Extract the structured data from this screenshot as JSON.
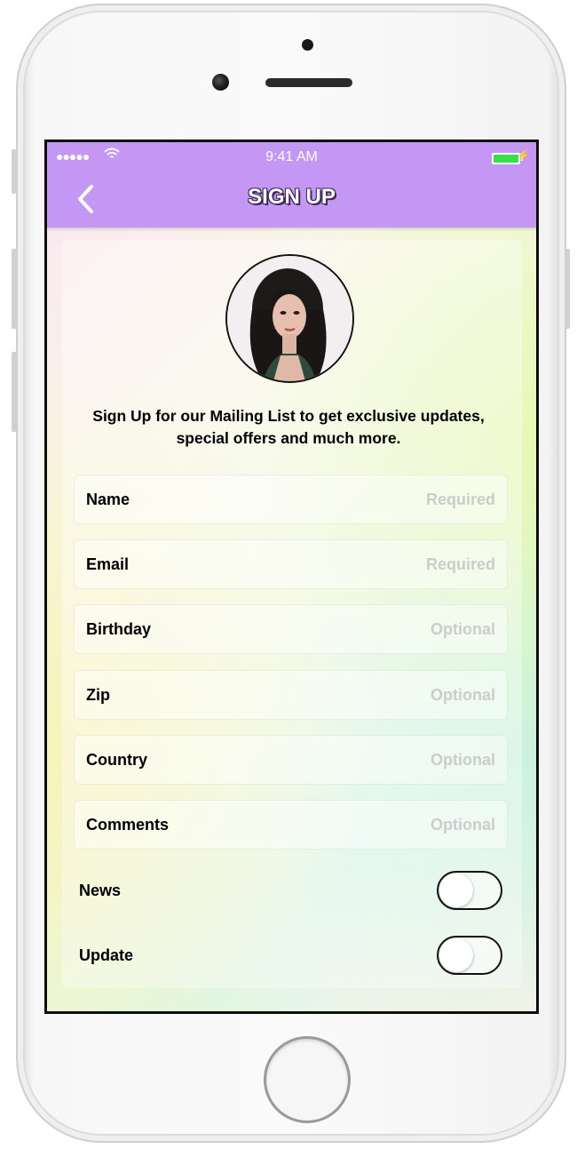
{
  "status_bar": {
    "signal": "●●●●●",
    "time": "9:41 AM"
  },
  "header": {
    "title": "SIGN UP",
    "back_icon": "chevron-left-icon"
  },
  "intro": {
    "line1": "Sign Up for our Mailing List to get exclusive updates,",
    "line2": "special offers and much more."
  },
  "fields": [
    {
      "label": "Name",
      "placeholder": "Required"
    },
    {
      "label": "Email",
      "placeholder": "Required"
    },
    {
      "label": "Birthday",
      "placeholder": "Optional"
    },
    {
      "label": "Zip",
      "placeholder": "Optional"
    },
    {
      "label": "Country",
      "placeholder": "Optional"
    },
    {
      "label": "Comments",
      "placeholder": "Optional"
    }
  ],
  "toggles": [
    {
      "label": "News",
      "on": false
    },
    {
      "label": "Update",
      "on": false
    }
  ],
  "colors": {
    "navbar": "#c597f4",
    "battery": "#37e04b",
    "hint": "#cccccc"
  }
}
